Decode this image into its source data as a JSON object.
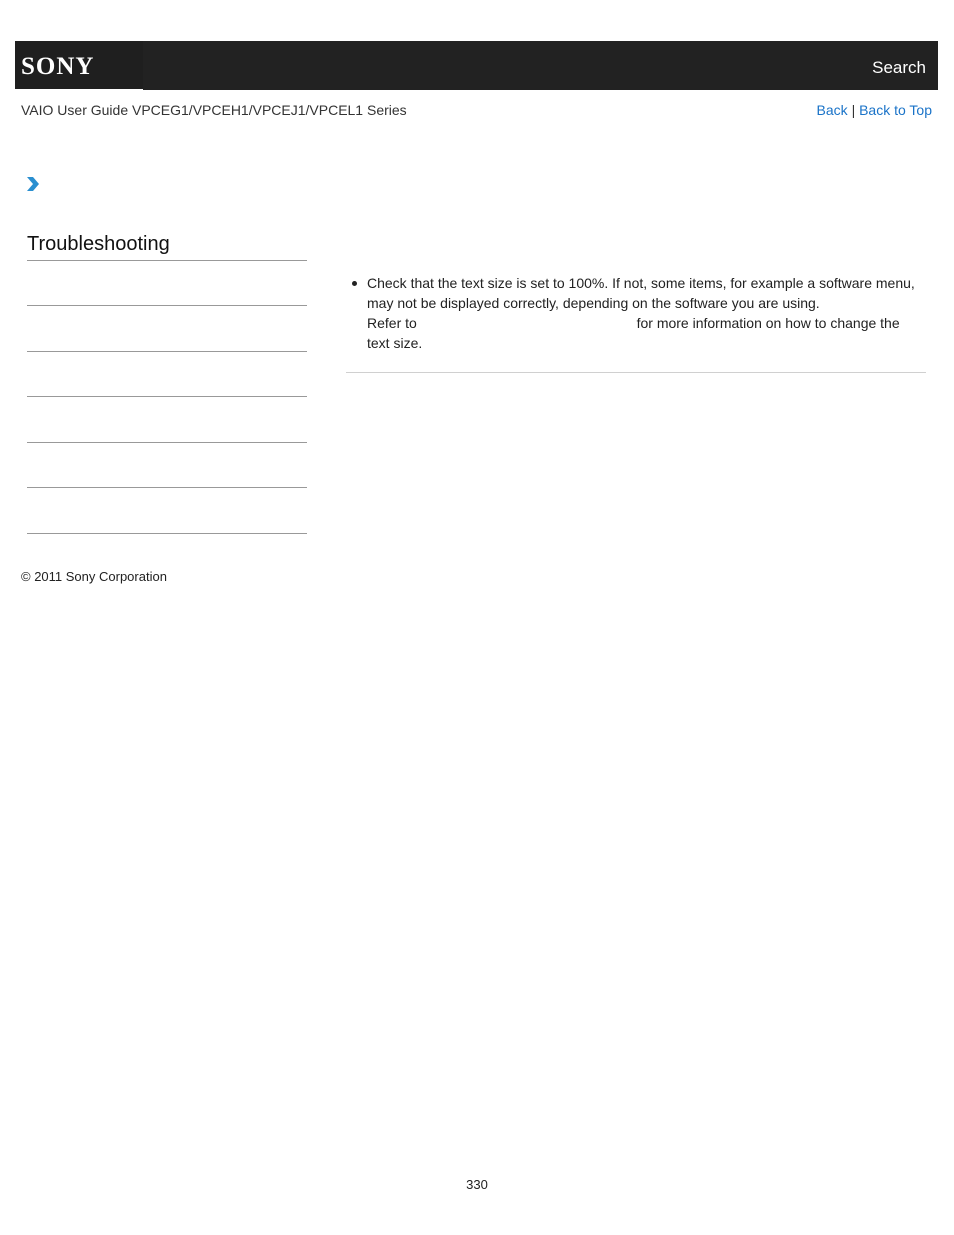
{
  "header": {
    "logo_text": "SONY",
    "search_label": "Search",
    "background_color": "#222222"
  },
  "subheader": {
    "guide_title": "VAIO User Guide VPCEG1/VPCEH1/VPCEJ1/VPCEL1 Series",
    "back_label": "Back",
    "separator": "|",
    "back_to_top_label": "Back to Top",
    "link_color": "#1a73c8"
  },
  "breadcrumb": {
    "icon": "chevron-right-icon",
    "icon_color": "#2a8fd0"
  },
  "sidebar": {
    "title": "Troubleshooting",
    "items": [
      "",
      "",
      "",
      "",
      "",
      ""
    ]
  },
  "content": {
    "bullet_line_1": "Check that the text size is set to 100%. If not, some items, for example a software menu,",
    "bullet_line_2": "may not be displayed correctly, depending on the software you are using.",
    "refer_prefix": "Refer to",
    "refer_suffix": "for more information on how to change the",
    "bullet_line_4": "text size."
  },
  "footer": {
    "copyright": "© 2011 Sony Corporation",
    "page_number": "330"
  }
}
